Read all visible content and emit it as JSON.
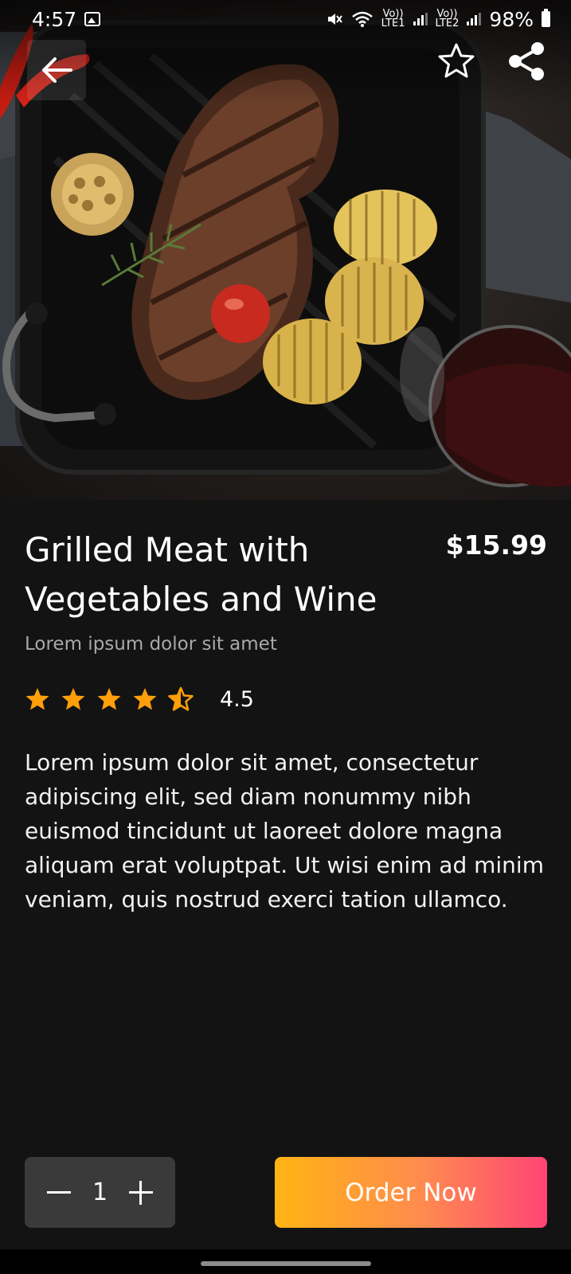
{
  "status_bar": {
    "time": "4:57",
    "lte1": "LTE1",
    "lte2": "LTE2",
    "volte": "Vo))",
    "battery": "98%"
  },
  "hero": {
    "image_icon": "food-photo",
    "back_icon": "arrow-left-icon",
    "favorite_icon": "star-outline-icon",
    "share_icon": "share-icon"
  },
  "product": {
    "title": "Grilled Meat with Vegetables and Wine",
    "price": "$15.99",
    "subtitle": "Lorem ipsum dolor sit amet",
    "rating": 4.5,
    "rating_label": "4.5",
    "rating_max": 5,
    "description": "Lorem ipsum dolor sit amet, consectetur adipiscing elit, sed diam nonummy nibh euismod tincidunt ut laoreet dolore magna aliquam erat voluptpat. Ut wisi enim ad minim veniam, quis nostrud exerci tation ullamco."
  },
  "actions": {
    "quantity": "1",
    "minus_icon": "minus-icon",
    "plus_icon": "plus-icon",
    "order_label": "Order Now"
  },
  "colors": {
    "background": "#131313",
    "star": "#ff9f0a",
    "order_gradient_start": "#ffb413",
    "order_gradient_end": "#ff4476",
    "quantity_box": "#3a3a3a"
  }
}
